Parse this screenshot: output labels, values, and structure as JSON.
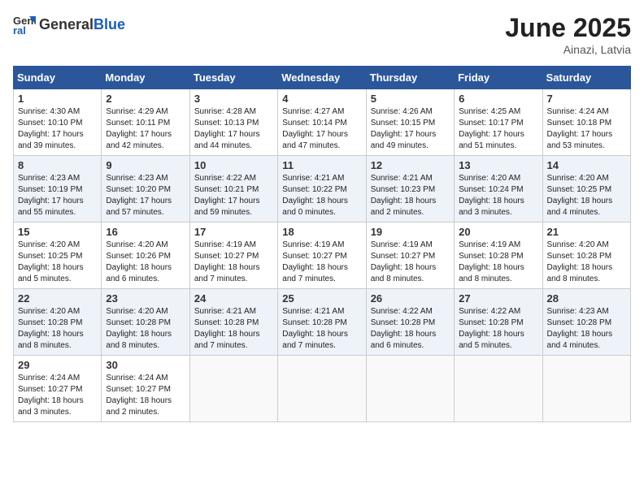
{
  "header": {
    "logo_general": "General",
    "logo_blue": "Blue",
    "month_year": "June 2025",
    "location": "Ainazi, Latvia"
  },
  "weekdays": [
    "Sunday",
    "Monday",
    "Tuesday",
    "Wednesday",
    "Thursday",
    "Friday",
    "Saturday"
  ],
  "weeks": [
    [
      {
        "day": "1",
        "info": "Sunrise: 4:30 AM\nSunset: 10:10 PM\nDaylight: 17 hours\nand 39 minutes."
      },
      {
        "day": "2",
        "info": "Sunrise: 4:29 AM\nSunset: 10:11 PM\nDaylight: 17 hours\nand 42 minutes."
      },
      {
        "day": "3",
        "info": "Sunrise: 4:28 AM\nSunset: 10:13 PM\nDaylight: 17 hours\nand 44 minutes."
      },
      {
        "day": "4",
        "info": "Sunrise: 4:27 AM\nSunset: 10:14 PM\nDaylight: 17 hours\nand 47 minutes."
      },
      {
        "day": "5",
        "info": "Sunrise: 4:26 AM\nSunset: 10:15 PM\nDaylight: 17 hours\nand 49 minutes."
      },
      {
        "day": "6",
        "info": "Sunrise: 4:25 AM\nSunset: 10:17 PM\nDaylight: 17 hours\nand 51 minutes."
      },
      {
        "day": "7",
        "info": "Sunrise: 4:24 AM\nSunset: 10:18 PM\nDaylight: 17 hours\nand 53 minutes."
      }
    ],
    [
      {
        "day": "8",
        "info": "Sunrise: 4:23 AM\nSunset: 10:19 PM\nDaylight: 17 hours\nand 55 minutes."
      },
      {
        "day": "9",
        "info": "Sunrise: 4:23 AM\nSunset: 10:20 PM\nDaylight: 17 hours\nand 57 minutes."
      },
      {
        "day": "10",
        "info": "Sunrise: 4:22 AM\nSunset: 10:21 PM\nDaylight: 17 hours\nand 59 minutes."
      },
      {
        "day": "11",
        "info": "Sunrise: 4:21 AM\nSunset: 10:22 PM\nDaylight: 18 hours\nand 0 minutes."
      },
      {
        "day": "12",
        "info": "Sunrise: 4:21 AM\nSunset: 10:23 PM\nDaylight: 18 hours\nand 2 minutes."
      },
      {
        "day": "13",
        "info": "Sunrise: 4:20 AM\nSunset: 10:24 PM\nDaylight: 18 hours\nand 3 minutes."
      },
      {
        "day": "14",
        "info": "Sunrise: 4:20 AM\nSunset: 10:25 PM\nDaylight: 18 hours\nand 4 minutes."
      }
    ],
    [
      {
        "day": "15",
        "info": "Sunrise: 4:20 AM\nSunset: 10:25 PM\nDaylight: 18 hours\nand 5 minutes."
      },
      {
        "day": "16",
        "info": "Sunrise: 4:20 AM\nSunset: 10:26 PM\nDaylight: 18 hours\nand 6 minutes."
      },
      {
        "day": "17",
        "info": "Sunrise: 4:19 AM\nSunset: 10:27 PM\nDaylight: 18 hours\nand 7 minutes."
      },
      {
        "day": "18",
        "info": "Sunrise: 4:19 AM\nSunset: 10:27 PM\nDaylight: 18 hours\nand 7 minutes."
      },
      {
        "day": "19",
        "info": "Sunrise: 4:19 AM\nSunset: 10:27 PM\nDaylight: 18 hours\nand 8 minutes."
      },
      {
        "day": "20",
        "info": "Sunrise: 4:19 AM\nSunset: 10:28 PM\nDaylight: 18 hours\nand 8 minutes."
      },
      {
        "day": "21",
        "info": "Sunrise: 4:20 AM\nSunset: 10:28 PM\nDaylight: 18 hours\nand 8 minutes."
      }
    ],
    [
      {
        "day": "22",
        "info": "Sunrise: 4:20 AM\nSunset: 10:28 PM\nDaylight: 18 hours\nand 8 minutes."
      },
      {
        "day": "23",
        "info": "Sunrise: 4:20 AM\nSunset: 10:28 PM\nDaylight: 18 hours\nand 8 minutes."
      },
      {
        "day": "24",
        "info": "Sunrise: 4:21 AM\nSunset: 10:28 PM\nDaylight: 18 hours\nand 7 minutes."
      },
      {
        "day": "25",
        "info": "Sunrise: 4:21 AM\nSunset: 10:28 PM\nDaylight: 18 hours\nand 7 minutes."
      },
      {
        "day": "26",
        "info": "Sunrise: 4:22 AM\nSunset: 10:28 PM\nDaylight: 18 hours\nand 6 minutes."
      },
      {
        "day": "27",
        "info": "Sunrise: 4:22 AM\nSunset: 10:28 PM\nDaylight: 18 hours\nand 5 minutes."
      },
      {
        "day": "28",
        "info": "Sunrise: 4:23 AM\nSunset: 10:28 PM\nDaylight: 18 hours\nand 4 minutes."
      }
    ],
    [
      {
        "day": "29",
        "info": "Sunrise: 4:24 AM\nSunset: 10:27 PM\nDaylight: 18 hours\nand 3 minutes."
      },
      {
        "day": "30",
        "info": "Sunrise: 4:24 AM\nSunset: 10:27 PM\nDaylight: 18 hours\nand 2 minutes."
      },
      {
        "day": "",
        "info": ""
      },
      {
        "day": "",
        "info": ""
      },
      {
        "day": "",
        "info": ""
      },
      {
        "day": "",
        "info": ""
      },
      {
        "day": "",
        "info": ""
      }
    ]
  ]
}
